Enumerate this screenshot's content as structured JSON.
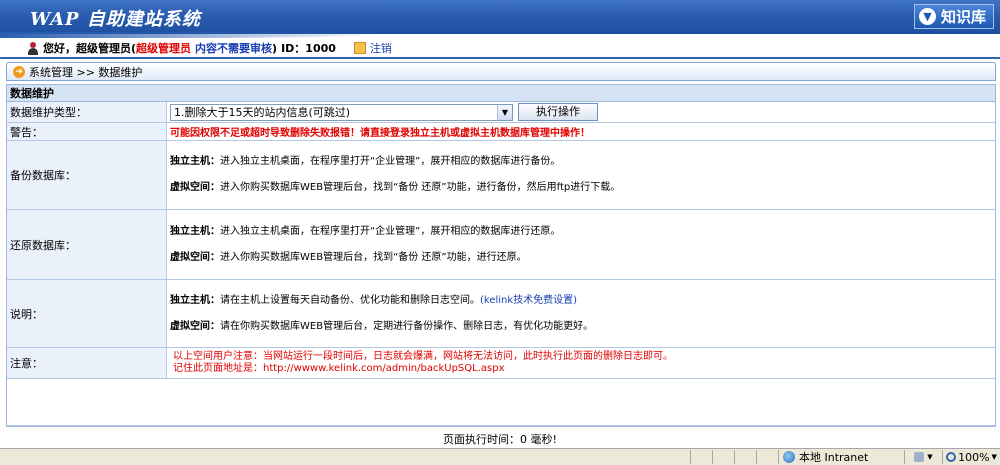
{
  "header": {
    "title": "WAP 自助建站系统",
    "kb_label": "知识库",
    "kb_icon": "down-arrow-circle-icon"
  },
  "userbar": {
    "greeting": "您好，超级管理员",
    "role_prefix": "(",
    "role": "超级管理员",
    "review_note": "内容不需要审核",
    "role_suffix": ")",
    "id_text": "ID：1000",
    "logout_label": "注销"
  },
  "breadcrumb": {
    "text": "系统管理 >> 数据维护"
  },
  "panel": {
    "title": "数据维护",
    "type_label": "数据维护类型：",
    "type_selected": "1.删除大于15天的站内信息(可跳过)",
    "execute_label": "执行操作",
    "warning_label": "警告：",
    "warning_text": "可能因权限不足或超时导致删除失败报错！请直接登录独立主机或虚拟主机数据库管理中操作！",
    "backup_label": "备份数据库：",
    "backup_line1_head": "独立主机：",
    "backup_line1_text": "进入独立主机桌面，在程序里打开“企业管理”，展开相应的数据库进行备份。",
    "backup_line2_head": "虚拟空间：",
    "backup_line2_text": "进入你购买数据库WEB管理后台，找到“备份 还原”功能，进行备份，然后用ftp进行下载。",
    "restore_label": "还原数据库：",
    "restore_line1_head": "独立主机：",
    "restore_line1_text": "进入独立主机桌面，在程序里打开“企业管理”，展开相应的数据库进行还原。",
    "restore_line2_head": "虚拟空间：",
    "restore_line2_text": "进入你购买数据库WEB管理后台，找到“备份 还原”功能，进行还原。",
    "desc_label": "说明：",
    "desc_line1_head": "独立主机：",
    "desc_line1_text": "请在主机上设置每天自动备份、优化功能和删除日志空间。",
    "desc_line1_link": "(kelink技术免费设置)",
    "desc_line2_head": "虚拟空间：",
    "desc_line2_text": "请在你购买数据库WEB管理后台，定期进行备份操作、删除日志，有优化功能更好。",
    "notice_label": "注意：",
    "notice_line1": "以上空间用户注意：当网站运行一段时间后，日志就会爆满，网站将无法访问，此时执行此页面的删除日志即可。",
    "notice_line2": "记住此页面地址是：http://wwww.kelink.com/admin/backUpSQL.aspx"
  },
  "footer": {
    "exec_time": "页面执行时间：0 毫秒!"
  },
  "statusbar": {
    "zone": "本地 Intranet",
    "zoom": "100%"
  }
}
